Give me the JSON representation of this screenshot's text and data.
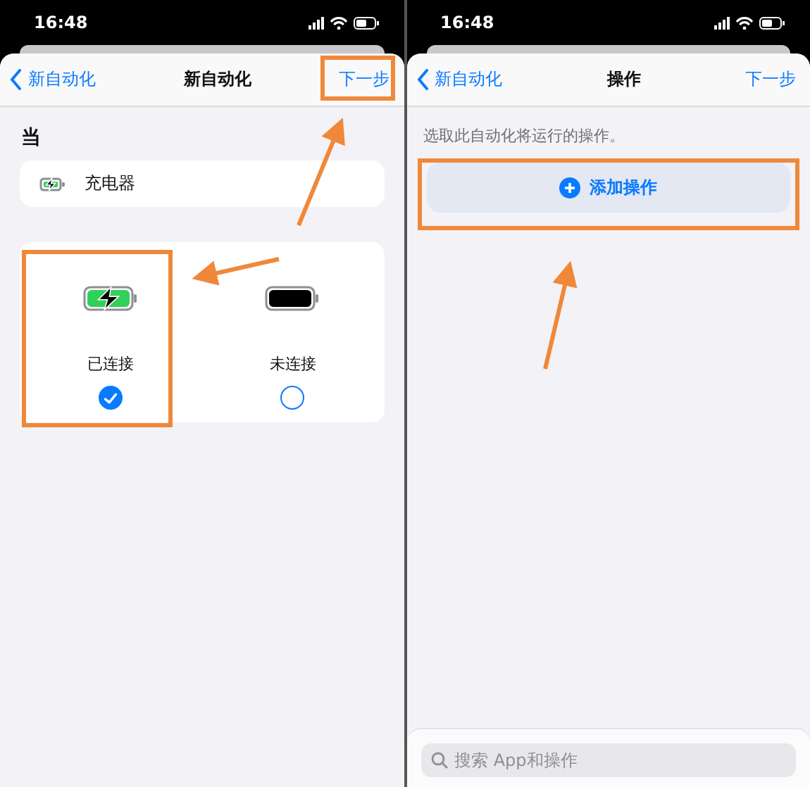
{
  "screens": [
    {
      "kind": "trigger",
      "status_bar": {
        "time": "16:48"
      },
      "nav": {
        "back": "新自动化",
        "title": "新自动化",
        "next": "下一步"
      },
      "section": "当",
      "trigger": {
        "label": "充电器"
      },
      "options": [
        {
          "label": "已连接",
          "kind": "charging",
          "selected": true
        },
        {
          "label": "未连接",
          "kind": "empty",
          "selected": false
        }
      ]
    },
    {
      "kind": "actions",
      "status_bar": {
        "time": "16:48"
      },
      "nav": {
        "back": "新自动化",
        "title": "操作",
        "next": "下一步"
      },
      "hint": "选取此自动化将运行的操作。",
      "add_button": "添加操作",
      "search": {
        "placeholder": "搜索 App和操作"
      }
    }
  ]
}
